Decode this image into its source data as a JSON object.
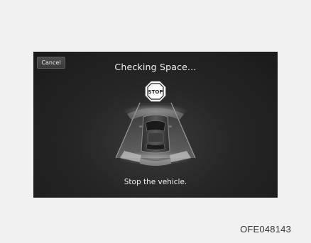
{
  "screen": {
    "cancel_label": "Cancel",
    "title": "Checking Space...",
    "stop_sign_label": "STOP",
    "message": "Stop the vehicle."
  },
  "figure": {
    "code": "OFE048143"
  },
  "icons": [
    "stop-sign-icon",
    "car-top-view-icon",
    "parking-sensor-icon"
  ],
  "colors": {
    "screen_background": "#262626",
    "text": "#f4f4f4",
    "stop_sign": "#ffffff"
  }
}
